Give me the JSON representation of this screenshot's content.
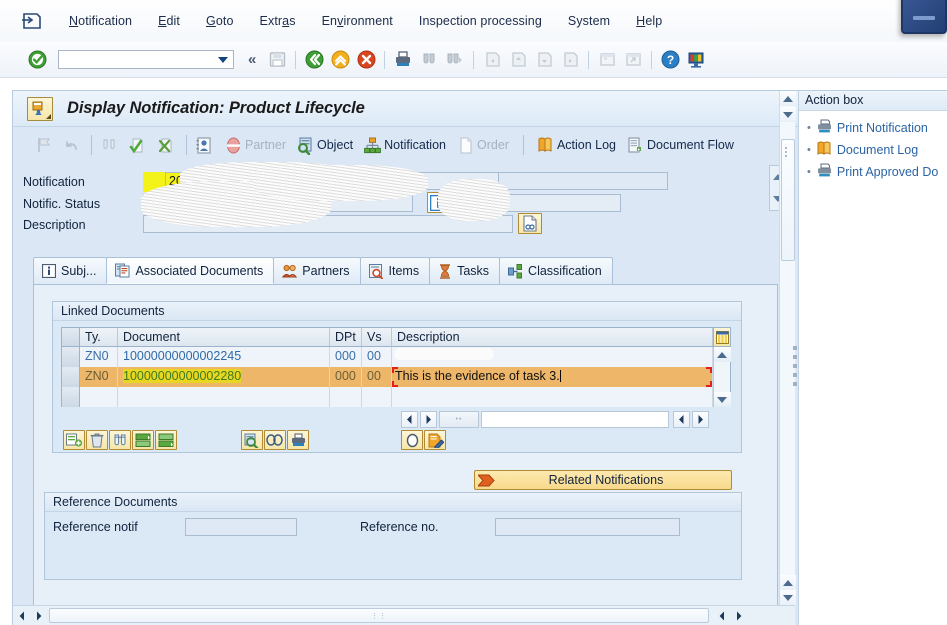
{
  "window": {
    "logo_icon": "sap-logo-icon",
    "maximize_control": "window-restore-control"
  },
  "menubar": {
    "items": [
      {
        "label": "Notification",
        "accel": "N"
      },
      {
        "label": "Edit",
        "accel": "E"
      },
      {
        "label": "Goto",
        "accel": "G"
      },
      {
        "label": "Extras",
        "accel": "a"
      },
      {
        "label": "Environment",
        "accel": "v"
      },
      {
        "label": "Inspection processing",
        "accel": ""
      },
      {
        "label": "System",
        "accel": ""
      },
      {
        "label": "Help",
        "accel": "H"
      }
    ]
  },
  "toolbar": {
    "enter_icon": "green-check-enter-icon",
    "command_field_value": "",
    "command_field_placeholder": "",
    "collapse_icon": "double-chevron-left-icon",
    "buttons": [
      {
        "icon": "save-icon",
        "enabled": false
      },
      {
        "icon": "back-green-icon",
        "enabled": true
      },
      {
        "icon": "exit-yellow-icon",
        "enabled": true
      },
      {
        "icon": "cancel-red-icon",
        "enabled": true
      },
      {
        "icon": "print-icon",
        "enabled": true
      },
      {
        "icon": "find-icon",
        "enabled": false
      },
      {
        "icon": "find-next-icon",
        "enabled": false
      },
      {
        "icon": "first-page-icon",
        "enabled": false
      },
      {
        "icon": "previous-page-icon",
        "enabled": false
      },
      {
        "icon": "next-page-icon",
        "enabled": false
      },
      {
        "icon": "last-page-icon",
        "enabled": false
      },
      {
        "icon": "create-session-icon",
        "enabled": false
      },
      {
        "icon": "create-shortcut-icon",
        "enabled": false
      },
      {
        "icon": "help-icon",
        "enabled": true
      },
      {
        "icon": "customize-local-layout-icon",
        "enabled": true
      }
    ]
  },
  "screen": {
    "title": "Display Notification: Product Lifecycle",
    "title_icon": "transaction-icon"
  },
  "app_toolbar": {
    "buttons": [
      {
        "label": "",
        "icon": "flag-icon",
        "enabled": false
      },
      {
        "label": "",
        "icon": "undo-icon",
        "enabled": false
      },
      {
        "label": "",
        "icon": "binoculars-icon",
        "enabled": false
      },
      {
        "label": "",
        "icon": "complete-task-icon",
        "enabled": false
      },
      {
        "label": "",
        "icon": "cancel-task-icon",
        "enabled": false
      },
      {
        "label": "",
        "icon": "address-icon",
        "enabled": true
      },
      {
        "label": "Partner",
        "icon": "partner-icon",
        "enabled": false
      },
      {
        "label": "Object",
        "icon": "object-icon",
        "enabled": true
      },
      {
        "label": "Notification",
        "icon": "notification-icon",
        "enabled": true
      },
      {
        "label": "Order",
        "icon": "order-icon",
        "enabled": false
      },
      {
        "label": "Action Log",
        "icon": "action-log-icon",
        "enabled": true
      },
      {
        "label": "Document Flow",
        "icon": "document-flow-icon",
        "enabled": true
      }
    ]
  },
  "header": {
    "fields": [
      {
        "label": "Notification",
        "value": "200030060",
        "highlighted": true
      },
      {
        "label": "Notific. Status",
        "value": ""
      },
      {
        "label": "Description",
        "value": ""
      }
    ],
    "info_icon": "info-blue-icon",
    "long_text_icon": "long-text-icon",
    "scroll_up_icon": "scroll-up-icon",
    "scroll_down_icon": "scroll-down-icon"
  },
  "tabs": [
    {
      "label": "Subj...",
      "icon": "subject-info-icon",
      "active": false
    },
    {
      "label": "Associated Documents",
      "icon": "associated-documents-icon",
      "active": true
    },
    {
      "label": "Partners",
      "icon": "partners-icon",
      "active": false
    },
    {
      "label": "Items",
      "icon": "items-icon",
      "active": false
    },
    {
      "label": "Tasks",
      "icon": "tasks-icon",
      "active": false
    },
    {
      "label": "Classification",
      "icon": "classification-icon",
      "active": false
    }
  ],
  "linked_documents": {
    "group_title": "Linked Documents",
    "columns": [
      "Ty.",
      "Document",
      "DPt",
      "Vs",
      "Description"
    ],
    "config_icon": "table-settings-icon",
    "rows": [
      {
        "type": "ZN0",
        "document": "10000000000002245",
        "dpt": "000",
        "vs": "00",
        "description": "",
        "selected": false,
        "highlighted": false
      },
      {
        "type": "ZN0",
        "document": "10000000000002280",
        "dpt": "000",
        "vs": "00",
        "description": "This is the evidence of task 3.",
        "selected": true,
        "highlighted": true
      },
      {
        "type": "",
        "document": "",
        "dpt": "",
        "vs": "",
        "description": "",
        "selected": false,
        "highlighted": false
      }
    ],
    "nav": {
      "first_icon": "nav-left-icon",
      "prev_icon": "nav-right-icon",
      "box_value": "",
      "col_left_icon": "column-left-icon",
      "col_right_icon": "column-right-icon"
    },
    "scroll_up_icon": "row-scroll-up-icon",
    "scroll_down_icon": "row-scroll-down-icon",
    "action_icons_left": [
      {
        "icon": "create-entry-icon"
      },
      {
        "icon": "delete-entry-icon"
      },
      {
        "icon": "find-entry-icon"
      },
      {
        "icon": "sort-ascending-icon"
      },
      {
        "icon": "sort-descending-icon"
      }
    ],
    "action_icons_middle": [
      {
        "icon": "display-document-icon"
      },
      {
        "icon": "link-document-icon"
      },
      {
        "icon": "print-document-icon"
      }
    ],
    "action_icons_right": [
      {
        "icon": "status-circle-icon"
      },
      {
        "icon": "edit-note-icon"
      }
    ]
  },
  "related_notifications_button": {
    "label": "Related Notifications",
    "icon": "orange-arrow-icon"
  },
  "reference_documents": {
    "group_title": "Reference Documents",
    "fields": [
      {
        "label": "Reference notif",
        "value": ""
      },
      {
        "label": "Reference no.",
        "value": ""
      }
    ]
  },
  "action_box": {
    "title": "Action box",
    "items": [
      {
        "label": "Print Notification",
        "icon": "printer-icon"
      },
      {
        "label": "Document Log",
        "icon": "document-log-icon"
      },
      {
        "label": "Print Approved Do",
        "icon": "printer-icon"
      }
    ]
  },
  "scrollbars": {
    "main_up_icon": "scroll-up-icon",
    "main_down_icon": "scroll-down-icon",
    "bottom_left_icon": "scroll-left-icon",
    "bottom_right_icon": "scroll-right-icon",
    "panel_left_icon": "panel-scroll-left-icon",
    "panel_right_icon": "panel-scroll-right-icon"
  },
  "colors": {
    "accent_blue": "#1c2c4a",
    "panel_blue": "#dbe7f4",
    "selected_row": "#eeb668",
    "highlight_yellow": "#f3f31a",
    "link_blue": "#2b63a5",
    "focus_red": "#e02020"
  }
}
